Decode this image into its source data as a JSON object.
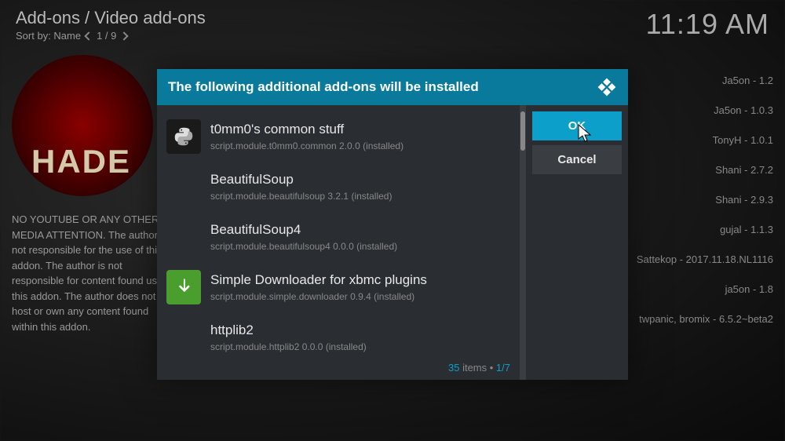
{
  "header": {
    "breadcrumb": "Add-ons / Video add-ons",
    "sort_label": "Sort by: Name",
    "sort_pos": "1 / 9",
    "clock": "11:19 AM"
  },
  "left": {
    "game_title": "HADES",
    "description": "NO YOUTUBE OR ANY OTHER MEDIA ATTENTION. The author is not responsible for the use of this addon. The author is not responsible for content found using this addon. The author does not host or own any content found within this addon."
  },
  "right": {
    "items": [
      "Ja5on - 1.2",
      "Ja5on - 1.0.3",
      "TonyH - 1.0.1",
      "Shani - 2.7.2",
      "Shani - 2.9.3",
      "gujal - 1.1.3",
      "Sattekop - 2017.11.18.NL1116",
      "ja5on - 1.8",
      "twpanic, bromix - 6.5.2~beta2"
    ]
  },
  "dialog": {
    "title": "The following additional add-ons will be installed",
    "ok": "OK",
    "cancel": "Cancel",
    "count": "35",
    "count_label": " items • ",
    "page": "1/7",
    "deps": [
      {
        "name": "t0mm0's common stuff",
        "detail": "script.module.t0mm0.common 2.0.0 (installed)",
        "icon": "python"
      },
      {
        "name": "BeautifulSoup",
        "detail": "script.module.beautifulsoup 3.2.1 (installed)",
        "icon": ""
      },
      {
        "name": "BeautifulSoup4",
        "detail": "script.module.beautifulsoup4 0.0.0 (installed)",
        "icon": ""
      },
      {
        "name": "Simple Downloader for xbmc plugins",
        "detail": "script.module.simple.downloader 0.9.4 (installed)",
        "icon": "download"
      },
      {
        "name": "httplib2",
        "detail": "script.module.httplib2 0.0.0 (installed)",
        "icon": ""
      }
    ]
  }
}
